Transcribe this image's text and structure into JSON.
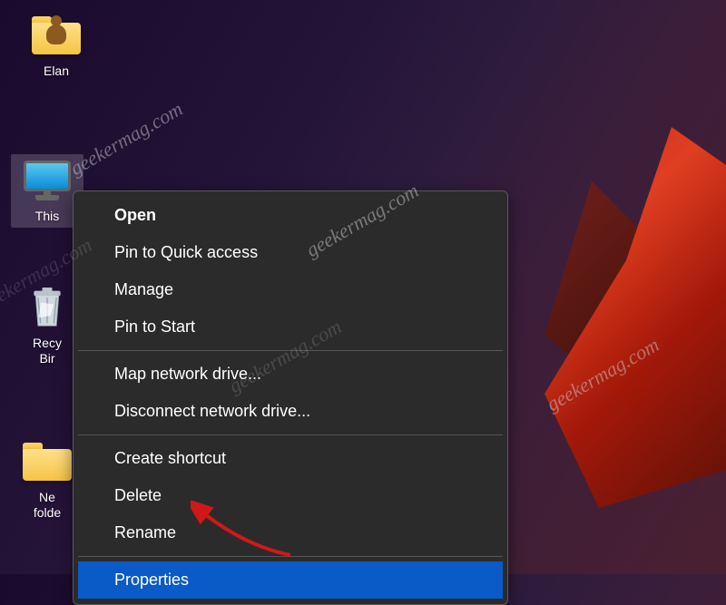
{
  "desktop": {
    "icons": {
      "elan": {
        "label": "Elan"
      },
      "this_pc": {
        "label": "This"
      },
      "recycle_bin": {
        "label_line1": "Recy",
        "label_line2": "Bir"
      },
      "new_folder": {
        "label_line1": "Ne",
        "label_line2": "folde"
      }
    }
  },
  "context_menu": {
    "items": {
      "open": "Open",
      "pin_quick": "Pin to Quick access",
      "manage": "Manage",
      "pin_start": "Pin to Start",
      "map_drive": "Map network drive...",
      "disconnect_drive": "Disconnect network drive...",
      "shortcut": "Create shortcut",
      "delete": "Delete",
      "rename": "Rename",
      "properties": "Properties"
    }
  },
  "watermark": {
    "text": "geekermag.com"
  }
}
